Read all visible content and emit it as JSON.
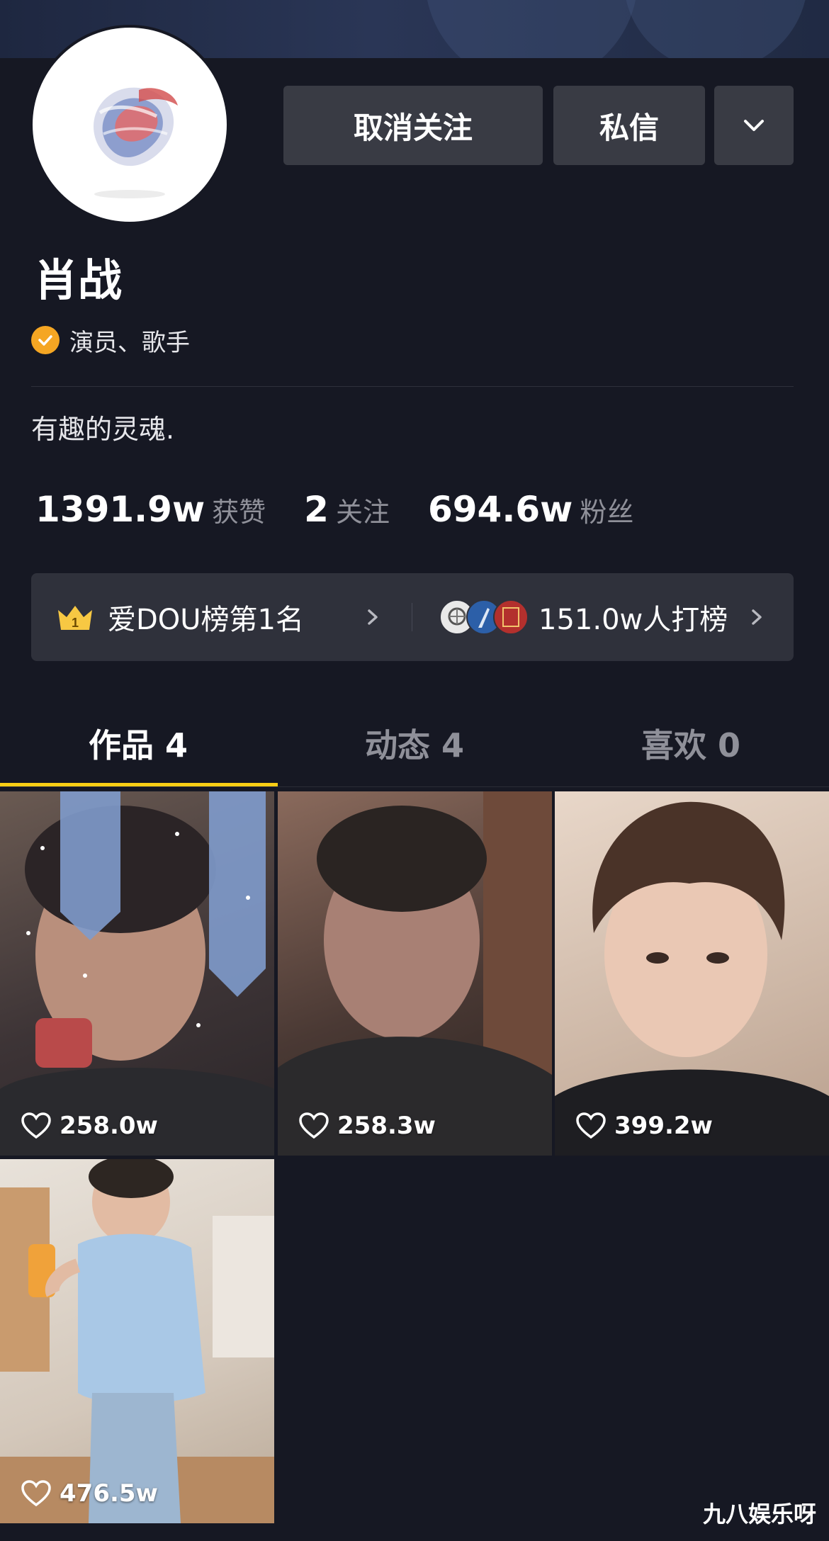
{
  "profile": {
    "name": "肖战",
    "verified_label": "演员、歌手",
    "bio": "有趣的灵魂."
  },
  "actions": {
    "unfollow_label": "取消关注",
    "message_label": "私信",
    "more_icon": "chevron-down-icon"
  },
  "stats": {
    "likes_value": "1391.9w",
    "likes_label": "获赞",
    "following_value": "2",
    "following_label": "关注",
    "followers_value": "694.6w",
    "followers_label": "粉丝"
  },
  "ranking": {
    "rank_icon": "crown-icon",
    "rank_badge": "1",
    "rank_text": "爱DOU榜第1名",
    "supporters_text": "151.0w人打榜"
  },
  "tabs": [
    {
      "label": "作品 4",
      "active": true
    },
    {
      "label": "动态 4",
      "active": false
    },
    {
      "label": "喜欢 0",
      "active": false
    }
  ],
  "videos": [
    {
      "likes": "258.0w"
    },
    {
      "likes": "258.3w"
    },
    {
      "likes": "399.2w"
    },
    {
      "likes": "476.5w"
    }
  ],
  "watermark": "九八娱乐呀",
  "colors": {
    "background": "#161823",
    "button": "#393b44",
    "tab_indicator": "#face15",
    "verify_badge": "#f5a623",
    "muted_text": "#8f9099"
  }
}
